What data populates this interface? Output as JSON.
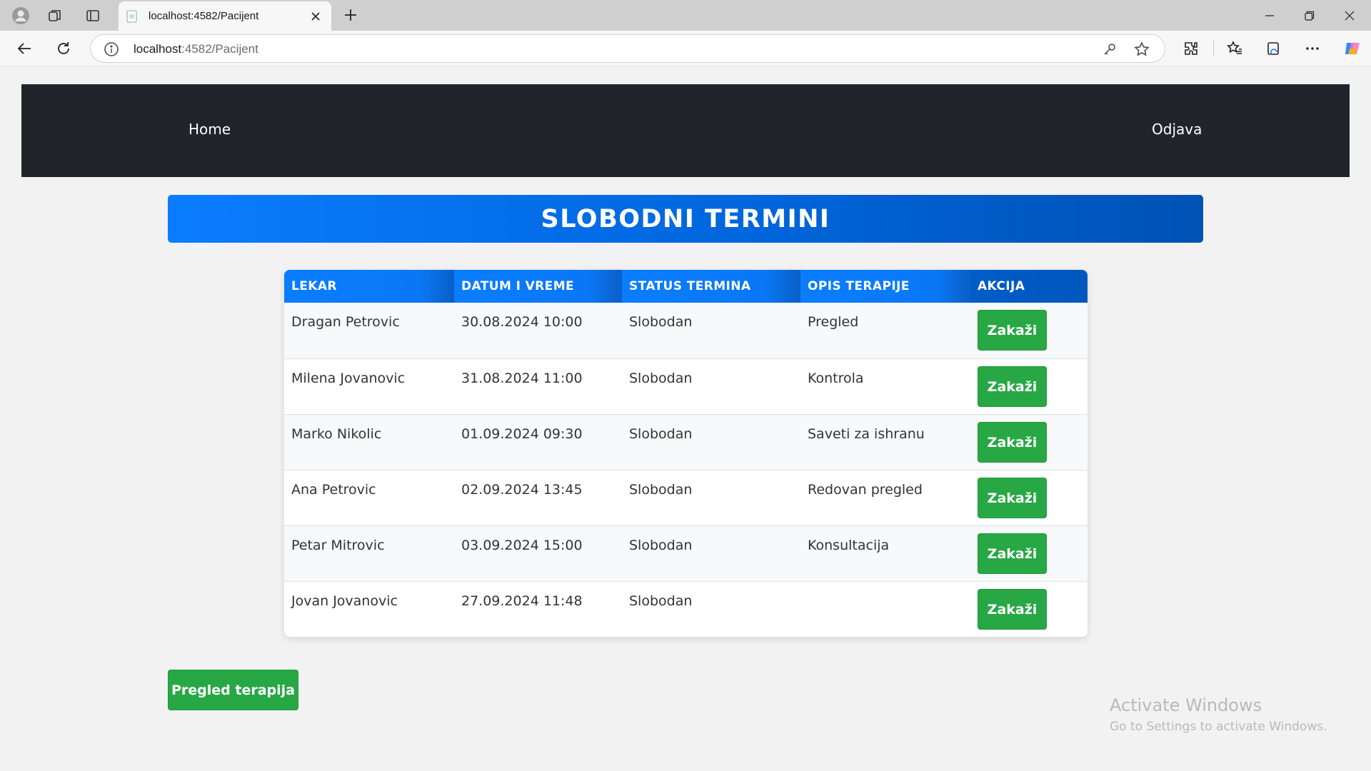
{
  "browser": {
    "tab_title": "localhost:4582/Pacijent",
    "address_host": "localhost",
    "address_path": ":4582/Pacijent"
  },
  "nav": {
    "home_label": "Home",
    "logout_label": "Odjava"
  },
  "banner": {
    "title": "SLOBODNI TERMINI"
  },
  "table": {
    "headers": [
      "LEKAR",
      "DATUM I VREME",
      "STATUS TERMINA",
      "OPIS TERAPIJE",
      "AKCIJA"
    ],
    "rows": [
      {
        "doctor": "Dragan Petrovic",
        "datetime": "30.08.2024 10:00",
        "status": "Slobodan",
        "description": "Pregled",
        "action": "Zakaži"
      },
      {
        "doctor": "Milena Jovanovic",
        "datetime": "31.08.2024 11:00",
        "status": "Slobodan",
        "description": "Kontrola",
        "action": "Zakaži"
      },
      {
        "doctor": "Marko Nikolic",
        "datetime": "01.09.2024 09:30",
        "status": "Slobodan",
        "description": "Saveti za ishranu",
        "action": "Zakaži"
      },
      {
        "doctor": "Ana Petrovic",
        "datetime": "02.09.2024 13:45",
        "status": "Slobodan",
        "description": "Redovan pregled",
        "action": "Zakaži"
      },
      {
        "doctor": "Petar Mitrovic",
        "datetime": "03.09.2024 15:00",
        "status": "Slobodan",
        "description": "Konsultacija",
        "action": "Zakaži"
      },
      {
        "doctor": "Jovan Jovanovic",
        "datetime": "27.09.2024 11:48",
        "status": "Slobodan",
        "description": "",
        "action": "Zakaži"
      }
    ]
  },
  "footer_button": {
    "label": "Pregled terapija"
  },
  "watermark": {
    "line1": "Activate Windows",
    "line2": "Go to Settings to activate Windows."
  },
  "colors": {
    "navbar": "#21252b",
    "accent_blue": "#0a7dff",
    "button_green": "#28a745"
  }
}
